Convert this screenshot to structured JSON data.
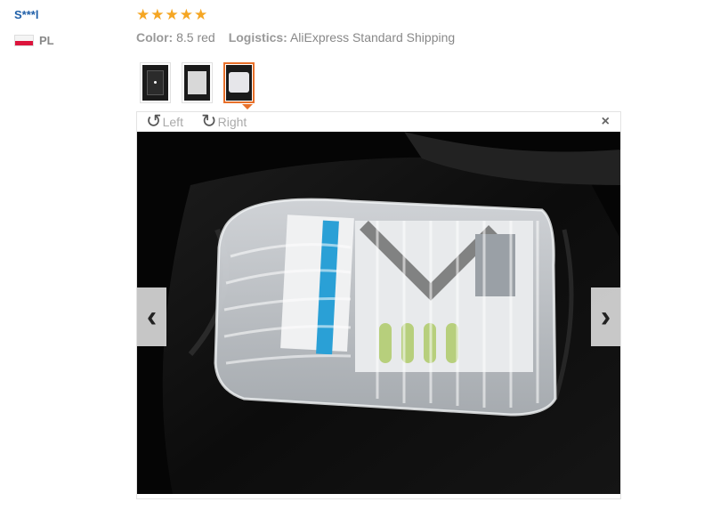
{
  "reviewer": {
    "name": "S***l",
    "country": "PL"
  },
  "rating": {
    "stars": 5,
    "max": 5
  },
  "details": {
    "color_label": "Color:",
    "color_value": "8.5 red",
    "logistics_label": "Logistics:",
    "logistics_value": "AliExpress Standard Shipping"
  },
  "thumbnails": [
    {
      "icon": "tablet-photo-icon",
      "active": false
    },
    {
      "icon": "tablet-box-photo-icon",
      "active": false
    },
    {
      "icon": "air-bag-package-photo-icon",
      "active": true
    }
  ],
  "viewer": {
    "rotate_left_label": "Left",
    "rotate_right_label": "Right",
    "rotate_left_icon": "rotate-left-icon",
    "rotate_right_icon": "rotate-right-icon",
    "close_icon": "close-icon",
    "prev_icon": "chevron-left-icon",
    "next_icon": "chevron-right-icon",
    "photo": "tablet box wrapped in inflatable air-column packaging on black car seat"
  },
  "colors": {
    "accent": "#e8702a",
    "star": "#f5a623",
    "username": "#1f5fa8"
  }
}
